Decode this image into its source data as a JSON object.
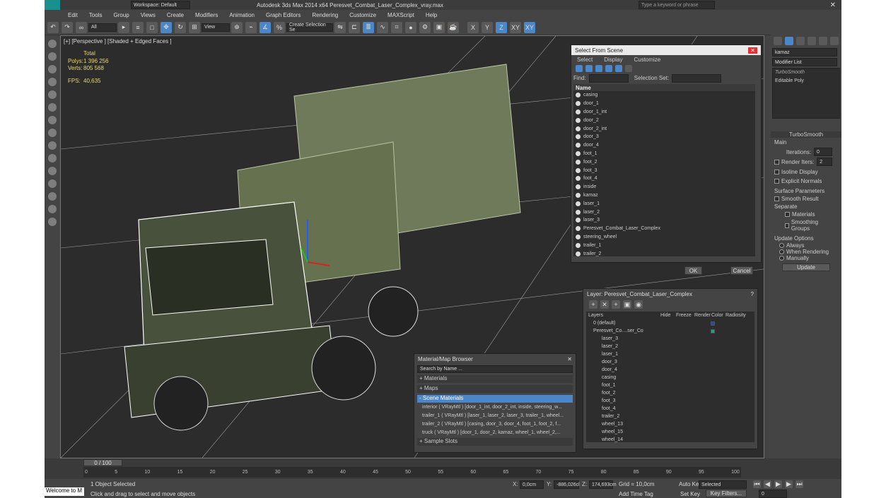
{
  "window": {
    "title": "Autodesk 3ds Max  2014 x64     Peresvet_Combat_Laser_Complex_vray.max",
    "workspace": "Workspace: Default",
    "search_placeholder": "Type a keyword or phrase"
  },
  "menu": [
    "Edit",
    "Tools",
    "Group",
    "Views",
    "Create",
    "Modifiers",
    "Animation",
    "Graph Editors",
    "Rendering",
    "Customize",
    "MAXScript",
    "Help"
  ],
  "toolbar": {
    "filter": "All",
    "ref_coord": "View",
    "selection_set": "Create Selection Se",
    "axis_x": "X",
    "axis_y": "Y",
    "axis_z": "Z",
    "axis_xy": "XY",
    "axis_xy2": "XY"
  },
  "viewport": {
    "label": "[+] [Perspective ] [Shaded + Edged Faces ]",
    "stats": {
      "total": "Total",
      "polys_label": "Polys:",
      "polys": "1 396 256",
      "verts_label": "Verts:",
      "verts": "805 568",
      "fps_label": "FPS:",
      "fps": "40,635"
    }
  },
  "select_scene": {
    "title": "Select From Scene",
    "menus": [
      "Select",
      "Display",
      "Customize"
    ],
    "find_label": "Find:",
    "selset_label": "Selection Set:",
    "column": "Name",
    "items": [
      "casing",
      "door_1",
      "door_1_int",
      "door_2",
      "door_2_int",
      "door_3",
      "door_4",
      "foot_1",
      "foot_2",
      "foot_3",
      "foot_4",
      "inside",
      "kamaz",
      "laser_1",
      "laser_2",
      "laser_3",
      "Peresvet_Combat_Laser_Complex",
      "steering_wheel",
      "trailer_1",
      "trailer_2"
    ],
    "ok": "OK",
    "cancel": "Cancel"
  },
  "layer": {
    "title": "Layer: Peresvet_Combat_Laser_Complex",
    "help": "?",
    "columns": [
      "Layers",
      "Hide",
      "Freeze",
      "Render",
      "Color",
      "Radiosity"
    ],
    "rows": [
      "0 (default)",
      "Peresvet_Co....ser_Co",
      "laser_3",
      "laser_2",
      "laser_1",
      "door_3",
      "door_4",
      "casing",
      "foot_1",
      "foot_2",
      "foot_3",
      "foot_4",
      "trailer_2",
      "wheel_13",
      "wheel_15",
      "wheel_14"
    ]
  },
  "material": {
    "title": "Material/Map Browser",
    "search": "Search by Name ...",
    "sections": [
      "+ Materials",
      "+ Maps",
      "- Scene Materials"
    ],
    "items": [
      "interior ( VRayMtl ) [door_1_int, door_2_int, inside, steering_w...",
      "trailer_1 ( VRayMtl ) [laser_1, laser_2, laser_3, trailer_1, wheel...",
      "trailer_2 ( VRayMtl ) [casing, door_3, door_4, foot_1, foot_2, f...",
      "truck ( VRayMtl ) [door_1, door_2, kamaz, wheel_1, wheel_2,..."
    ],
    "sample_slots": "+ Sample Slots"
  },
  "cmd": {
    "object_name": "kamaz",
    "modifier_list": "Modifier List",
    "stack": [
      "TurboSmooth",
      "Editable Poly"
    ],
    "rollout": "TurboSmooth",
    "main": "Main",
    "iterations_label": "Iterations:",
    "iterations": "0",
    "render_iters_label": "Render Iters:",
    "render_iters": "2",
    "isoline": "Isoline Display",
    "explicit": "Explicit Normals",
    "surface": "Surface Parameters",
    "smooth": "Smooth Result",
    "separate": "Separate",
    "materials": "Materials",
    "smoothing": "Smoothing Groups",
    "update_opts": "Update Options",
    "always": "Always",
    "when_render": "When Rendering",
    "manually": "Manually",
    "update": "Update"
  },
  "timeline": {
    "frame": "0 / 100",
    "ticks": [
      "0",
      "5",
      "10",
      "15",
      "20",
      "25",
      "30",
      "35",
      "40",
      "45",
      "50",
      "55",
      "60",
      "65",
      "70",
      "75",
      "80",
      "85",
      "90",
      "95",
      "100"
    ]
  },
  "status": {
    "maxscript": "Welcome to M",
    "selected": "1 Object Selected",
    "prompt": "Click and drag to select and move objects",
    "x_label": "X:",
    "x": "0,0cm",
    "y_label": "Y:",
    "y": "-886,026cl",
    "z_label": "Z:",
    "z": "174,693cm",
    "grid": "Grid = 10,0cm",
    "add_time_tag": "Add Time Tag",
    "auto_key": "Auto Key",
    "set_key": "Set Key",
    "key_mode": "Selected",
    "key_filters": "Key Filters...",
    "frame_field": "0"
  }
}
